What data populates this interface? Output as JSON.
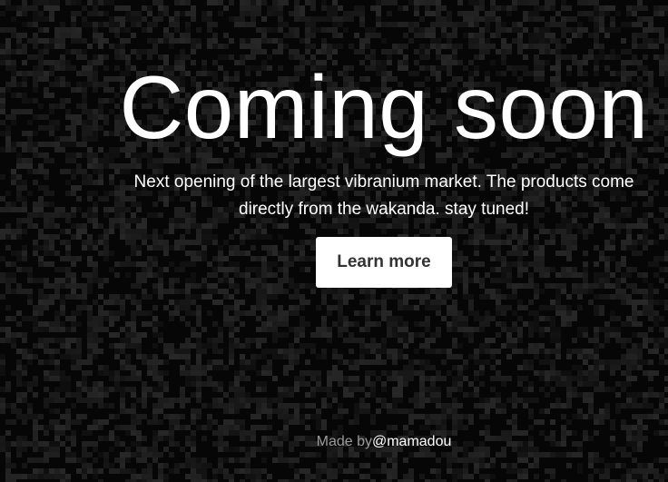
{
  "hero": {
    "title": "Coming soon",
    "subtitle": "Next opening of the largest vibranium market. The products come directly from the wakanda. stay tuned!",
    "cta_label": "Learn more"
  },
  "footer": {
    "prefix": "Made by",
    "author_link": "@mamadou"
  },
  "colors": {
    "background": "#060606",
    "text": "#ffffff",
    "button_background": "#ffffff",
    "button_text": "#333333",
    "muted": "#9a9a9a"
  }
}
